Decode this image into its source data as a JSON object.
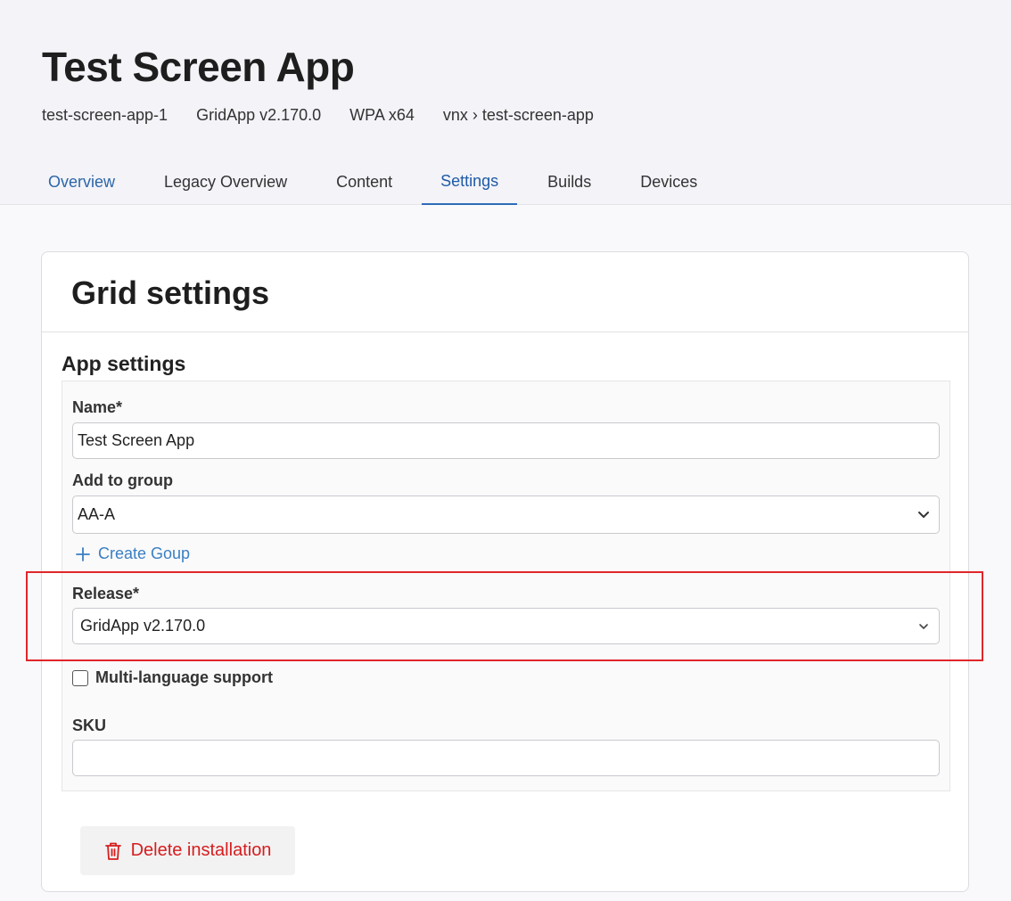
{
  "header": {
    "title": "Test Screen App",
    "meta": [
      "test-screen-app-1",
      "GridApp v2.170.0",
      "WPA x64",
      "vnx › test-screen-app"
    ]
  },
  "tabs": [
    {
      "label": "Overview"
    },
    {
      "label": "Legacy Overview"
    },
    {
      "label": "Content"
    },
    {
      "label": "Settings"
    },
    {
      "label": "Builds"
    },
    {
      "label": "Devices"
    }
  ],
  "card": {
    "title": "Grid settings",
    "section_title": "App settings"
  },
  "form": {
    "name_label": "Name*",
    "name_value": "Test Screen App",
    "group_label": "Add to group",
    "group_value": "AA-A",
    "create_group_label": "Create Goup",
    "release_label": "Release*",
    "release_value": "GridApp v2.170.0",
    "multilang_label": "Multi-language support",
    "sku_label": "SKU",
    "sku_value": ""
  },
  "delete_label": "Delete installation",
  "colors": {
    "accent": "#2c6bb8",
    "link": "#3a7fc1",
    "danger": "#d61d1d",
    "highlight": "#e0262a"
  }
}
